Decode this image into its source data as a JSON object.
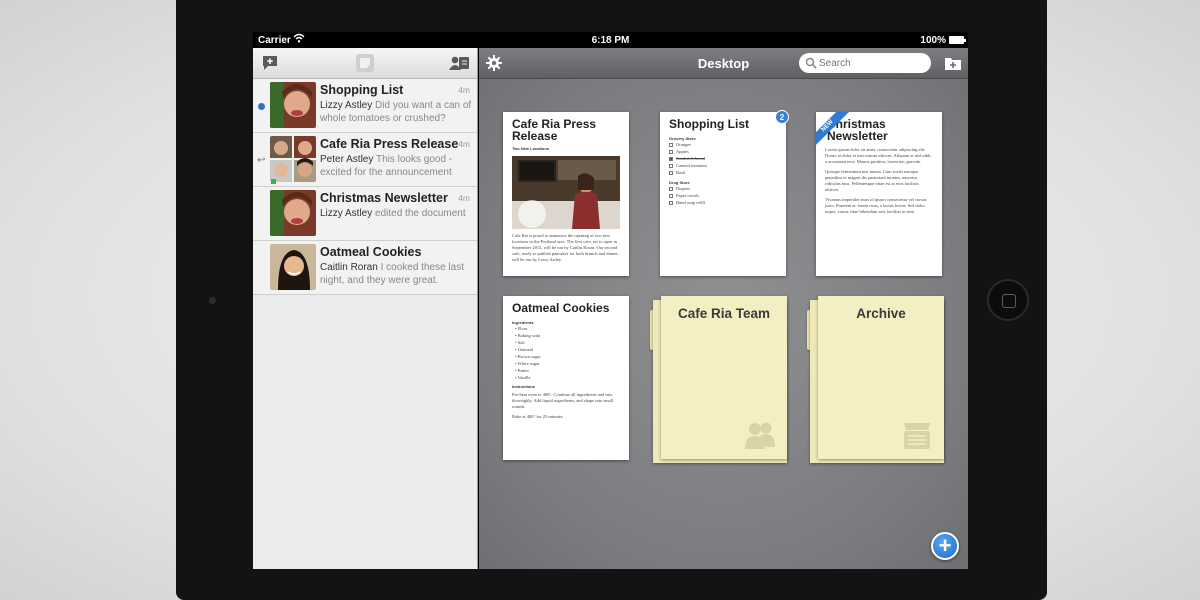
{
  "status_bar": {
    "carrier": "Carrier",
    "time": "6:18 PM",
    "battery": "100%"
  },
  "sidebar": {
    "conversations": [
      {
        "title": "Shopping List",
        "time": "4m",
        "sender": "Lizzy Astley",
        "message": "Did you want a can of whole tomatoes or crushed?",
        "unread": true
      },
      {
        "title": "Cafe Ria Press Release",
        "time": "4m",
        "sender": "Peter Astley",
        "message": "This looks good - excited for the announcement",
        "unread": false
      },
      {
        "title": "Christmas Newsletter",
        "time": "4m",
        "sender": "Lizzy Astley",
        "message": "edited the document",
        "unread": false
      },
      {
        "title": "Oatmeal Cookies",
        "time": "",
        "sender": "Caitlin Roran",
        "message": "I cooked these last night, and they were great.",
        "unread": false
      }
    ]
  },
  "desktop": {
    "title": "Desktop",
    "search_placeholder": "Search",
    "documents": {
      "press": {
        "title": "Cafe Ria Press Release",
        "subtitle": "Two New Locations",
        "body": "Cafe Ria is proud to announce the opening of two new locations in the Portland area. The first cafe, set to open in September 2013, will be run by Caitlin Roran. Our second cafe, ready to publish pancakes for both brunch and dinner, will be run by Lizzy Astley."
      },
      "shopping": {
        "title": "Shopping List",
        "badge": "2",
        "grocery_heading": "Grocery Store",
        "grocery_items": [
          "Oranges",
          "Apples",
          "Sandwich bread",
          "Canned tomatoes",
          "Basil"
        ],
        "drug_heading": "Drug Store",
        "drug_items": [
          "Diapers",
          "Paper towels",
          "Hand soap refill"
        ]
      },
      "newsletter": {
        "title": "Christmas Newsletter",
        "ribbon": "NEW",
        "p1": "Lorem ipsum dolor sit amet, consectetur adipiscing elit. Donec at dolor et nisi rutrum ultrices. Aliquam et nisl nibh, a accumsan eros. Mauris porttitor, lorem nec gravida.",
        "p2": "Quisque fermentum nisi massa. Cum sociis natoque penatibus et magnis dis parturient montes, nascetur ridiculus mus. Pellentesque vitae est at eros facilisis ultrices.",
        "p3": "Vivamus imperdiet risus id ipsum consectetur vel cursus justo. Praesent ac lorem risus, a luctus lectus. Sed dolor turpis, varius vitae bibendum sed, facilisis in sem."
      },
      "cookies": {
        "title": "Oatmeal Cookies",
        "ingredients_heading": "Ingredients",
        "ingredients": [
          "Flour",
          "Baking soda",
          "Salt",
          "Oatmeal",
          "Brown sugar",
          "White sugar",
          "Butter",
          "Vanilla"
        ],
        "instructions_heading": "Instructions",
        "step1": "Pre-heat oven to 400°. Combine all ingredients and mix thoroughly. Add liquid ingredients, and shape into small rounds.",
        "step2": "Bake at 400° for 25 minutes."
      }
    },
    "folders": [
      {
        "name": "Cafe Ria Team",
        "icon": "people-icon"
      },
      {
        "name": "Archive",
        "icon": "archive-box-icon"
      }
    ]
  }
}
